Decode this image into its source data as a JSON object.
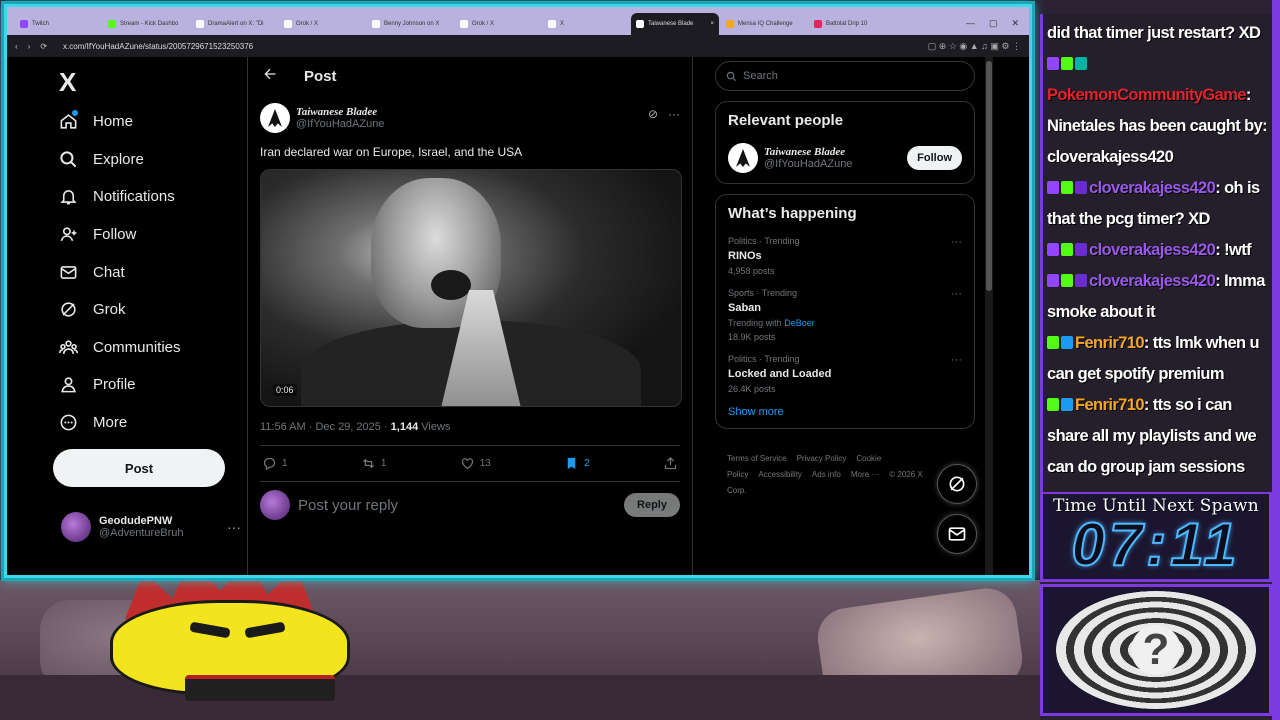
{
  "browser": {
    "tabs": [
      {
        "label": "Twitch",
        "color": "#9146ff",
        "active": false
      },
      {
        "label": "Stream - Kick Dashbo",
        "color": "#53fc18",
        "active": false
      },
      {
        "label": "DramaAlert on X: \"Di",
        "color": "#ffffff",
        "active": false
      },
      {
        "label": "Grok / X",
        "color": "#ffffff",
        "active": false
      },
      {
        "label": "Benny Johnson on X",
        "color": "#ffffff",
        "active": false
      },
      {
        "label": "Grok / X",
        "color": "#ffffff",
        "active": false
      },
      {
        "label": "X",
        "color": "#ffffff",
        "active": false
      },
      {
        "label": "Taiwanese Blade",
        "color": "#ffffff",
        "active": true
      },
      {
        "label": "Mensa IQ Challenge",
        "color": "#f5a623",
        "active": false
      },
      {
        "label": "Battolat Drip 10",
        "color": "#e0245e",
        "active": false
      }
    ],
    "url": "x.com/IfYouHadAZune/status/2005729671523250376"
  },
  "nav": {
    "logo": "X",
    "items": [
      {
        "label": "Home",
        "icon": "home-icon"
      },
      {
        "label": "Explore",
        "icon": "search-icon"
      },
      {
        "label": "Notifications",
        "icon": "bell-icon"
      },
      {
        "label": "Follow",
        "icon": "person-add-icon"
      },
      {
        "label": "Chat",
        "icon": "mail-icon"
      },
      {
        "label": "Grok",
        "icon": "grok-icon"
      },
      {
        "label": "Communities",
        "icon": "communities-icon"
      },
      {
        "label": "Profile",
        "icon": "profile-icon"
      },
      {
        "label": "More",
        "icon": "more-circle-icon"
      }
    ],
    "post_label": "Post",
    "account": {
      "name": "GeodudePNW",
      "handle": "@AdventureBruh",
      "more": "···"
    }
  },
  "main": {
    "header_title": "Post",
    "author": {
      "name": "Taiwanese Bladee",
      "handle": "@IfYouHadAZune"
    },
    "text": "Iran declared war on Europe, Israel, and the USA",
    "video_time": "0:06",
    "time": "11:56 AM",
    "date": "Dec 29, 2025",
    "views_count": "1,144",
    "views_label": "Views",
    "actions": {
      "replies": "1",
      "reposts": "1",
      "likes": "13",
      "bookmarks": "2"
    },
    "reply_placeholder": "Post your reply",
    "reply_button": "Reply"
  },
  "right": {
    "search_placeholder": "Search",
    "relevant_title": "Relevant people",
    "relevant_person": {
      "name": "Taiwanese Bladee",
      "handle": "@IfYouHadAZune",
      "follow": "Follow"
    },
    "happening_title": "What’s happening",
    "trends": [
      {
        "context": "Politics · Trending",
        "title": "RINOs",
        "with_prefix": "",
        "with_link": "",
        "count": "4,958 posts"
      },
      {
        "context": "Sports · Trending",
        "title": "Saban",
        "with_prefix": "Trending with",
        "with_link": "DeBoer",
        "count": "18.9K posts"
      },
      {
        "context": "Politics · Trending",
        "title": "Locked and Loaded",
        "with_prefix": "",
        "with_link": "",
        "count": "26.4K posts"
      }
    ],
    "show_more": "Show more",
    "footer": [
      "Terms of Service",
      "Privacy Policy",
      "Cookie Policy",
      "Accessibility",
      "Ads info",
      "More ···",
      "© 2026 X Corp."
    ]
  },
  "chat": {
    "messages": [
      {
        "user": "",
        "user_color": "#ffffff",
        "text": "did that timer just restart? XD",
        "badges": []
      },
      {
        "user": "PokemonCommunityGame",
        "user_color": "#e0242a",
        "text": ": Ninetales has been caught by: cloverakajess420",
        "badges": [
          "#9146ff",
          "#53fc18",
          "#00b3a4"
        ]
      },
      {
        "user": "cloverakajess420",
        "user_color": "#9a58e8",
        "text": ": oh is that the pcg timer? XD",
        "badges": [
          "#9146ff",
          "#53fc18",
          "#6a2bd0"
        ]
      },
      {
        "user": "cloverakajess420",
        "user_color": "#9a58e8",
        "text": ": !wtf",
        "badges": [
          "#9146ff",
          "#53fc18",
          "#6a2bd0"
        ]
      },
      {
        "user": "cloverakajess420",
        "user_color": "#9a58e8",
        "text": ": Imma smoke about it",
        "badges": [
          "#9146ff",
          "#53fc18",
          "#6a2bd0"
        ]
      },
      {
        "user": "Fenrir710",
        "user_color": "#f5a623",
        "text": ": tts lmk when u can get spotify premium",
        "badges": [
          "#53fc18",
          "#1d9bf0"
        ]
      },
      {
        "user": "Fenrir710",
        "user_color": "#f5a623",
        "text": ": tts so i can share all my playlists and we can do group jam sessions",
        "badges": [
          "#53fc18",
          "#1d9bf0"
        ]
      }
    ]
  },
  "timer": {
    "label": "Time Until Next Spawn",
    "value": "07:11"
  }
}
